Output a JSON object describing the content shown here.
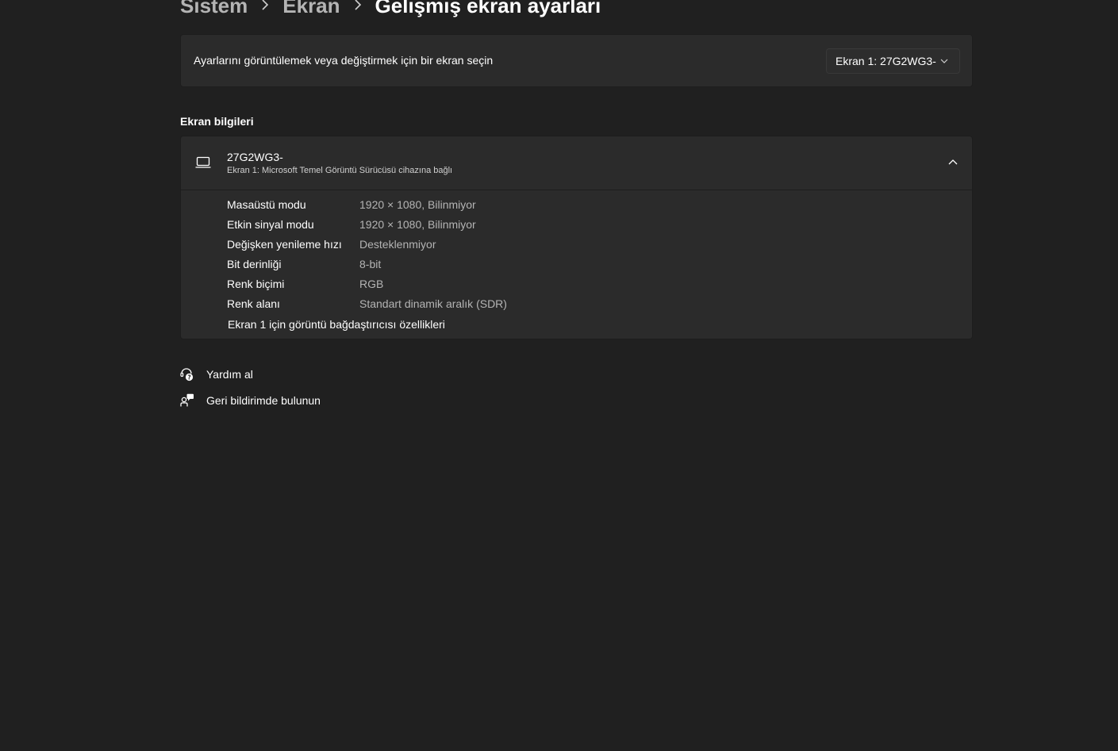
{
  "breadcrumb": {
    "items": [
      "Sistem",
      "Ekran"
    ],
    "current": "Gelişmiş ekran ayarları"
  },
  "display_select": {
    "label": "Ayarlarını görüntülemek veya değiştirmek için bir ekran seçin",
    "selected": "Ekran 1: 27G2WG3-",
    "icon": "chevron-down-icon"
  },
  "display_info": {
    "section_title": "Ekran bilgileri",
    "monitor_name": "27G2WG3-",
    "monitor_subtitle": "Ekran 1: Microsoft Temel Görüntü Sürücüsü cihazına bağlı",
    "rows": [
      {
        "key": "Masaüstü modu",
        "value": "1920 × 1080, Bilinmiyor"
      },
      {
        "key": "Etkin sinyal modu",
        "value": "1920 × 1080, Bilinmiyor"
      },
      {
        "key": "Değişken yenileme hızı",
        "value": "Desteklenmiyor"
      },
      {
        "key": "Bit derinliği",
        "value": "8-bit"
      },
      {
        "key": "Renk biçimi",
        "value": "RGB"
      },
      {
        "key": "Renk alanı",
        "value": "Standart dinamik aralık (SDR)"
      }
    ],
    "adapter_link": "Ekran 1 için görüntü bağdaştırıcısı özellikleri"
  },
  "footer": {
    "help": "Yardım al",
    "feedback": "Geri bildirimde bulunun"
  },
  "colors": {
    "background": "#202020",
    "card": "#2b2b2b",
    "text": "#ffffff",
    "secondary_text": "#b4b4b4"
  }
}
